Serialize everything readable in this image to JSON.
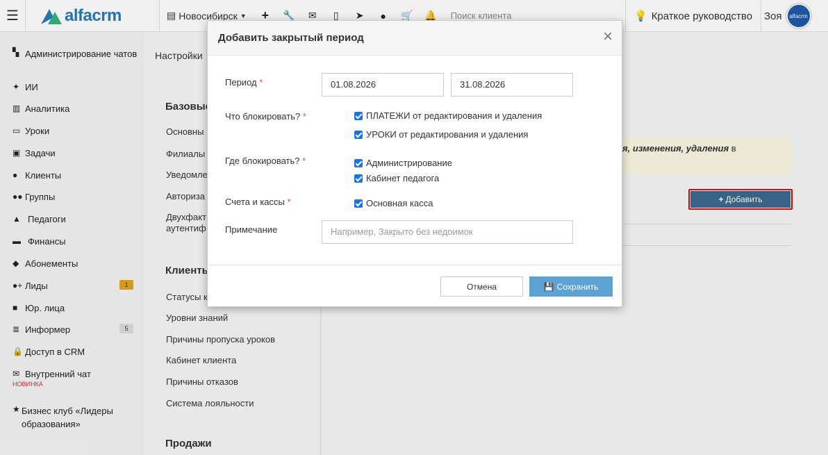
{
  "topbar": {
    "logo_text": "alfacrm",
    "branch": "Новосибирск",
    "search_placeholder": "Поиск клиента",
    "guide_label": "Краткое руководство",
    "user_name": "Зоя",
    "avatar_text": "alfacrm"
  },
  "sidebar": {
    "items": [
      {
        "label": "Администрирование чатов"
      },
      {
        "label": "ИИ"
      },
      {
        "label": "Аналитика"
      },
      {
        "label": "Уроки"
      },
      {
        "label": "Задачи"
      },
      {
        "label": "Клиенты"
      },
      {
        "label": "Группы"
      },
      {
        "label": "Педагоги"
      },
      {
        "label": "Финансы"
      },
      {
        "label": "Абонементы"
      },
      {
        "label": "Лиды",
        "badge": "1"
      },
      {
        "label": "Юр. лица"
      },
      {
        "label": "Информер",
        "badge": "5"
      },
      {
        "label": "Доступ в CRM"
      },
      {
        "label": "Внутренний чат",
        "tag": "НОВИНКА"
      },
      {
        "label": "Бизнес клуб «Лидеры образования»"
      }
    ]
  },
  "settings": {
    "crumb": "Настройки",
    "group1": "Базовые",
    "group1_links": [
      "Основны",
      "Филиалы",
      "Уведомле",
      "Авториза",
      "Двухфакт аутентиф"
    ],
    "group2": "Клиенты",
    "group2_links": [
      "Статусы к",
      "Уровни знаний",
      "Причины пропуска уроков",
      "Кабинет клиента",
      "Причины отказов",
      "Система лояльности"
    ],
    "group3": "Продажи"
  },
  "main": {
    "notice_part1": "ения, изменения, удаления",
    "notice_part2": "в",
    "add_button": "Добавить"
  },
  "modal": {
    "title": "Добавить закрытый период",
    "period_label": "Период",
    "period_from": "01.08.2026",
    "period_to": "31.08.2026",
    "what_label": "Что блокировать?",
    "what_options": [
      "ПЛАТЕЖИ от редактирования и удаления",
      "УРОКИ от редактирования и удаления"
    ],
    "where_label": "Где блокировать?",
    "where_options": [
      "Администрирование",
      "Кабинет педагога"
    ],
    "accounts_label": "Счета и кассы",
    "accounts_options": [
      "Основная касса"
    ],
    "note_label": "Примечание",
    "note_placeholder": "Например, Закрыто без недоимок",
    "cancel": "Отмена",
    "save": "Сохранить",
    "required_mark": "*"
  },
  "colors": {
    "accent": "#2a7bb8",
    "save_button": "#5ba3d5",
    "add_button": "#3d6a8e",
    "checkbox": "#1a73e8",
    "required": "#d9534f",
    "highlight": "#ee0000"
  }
}
